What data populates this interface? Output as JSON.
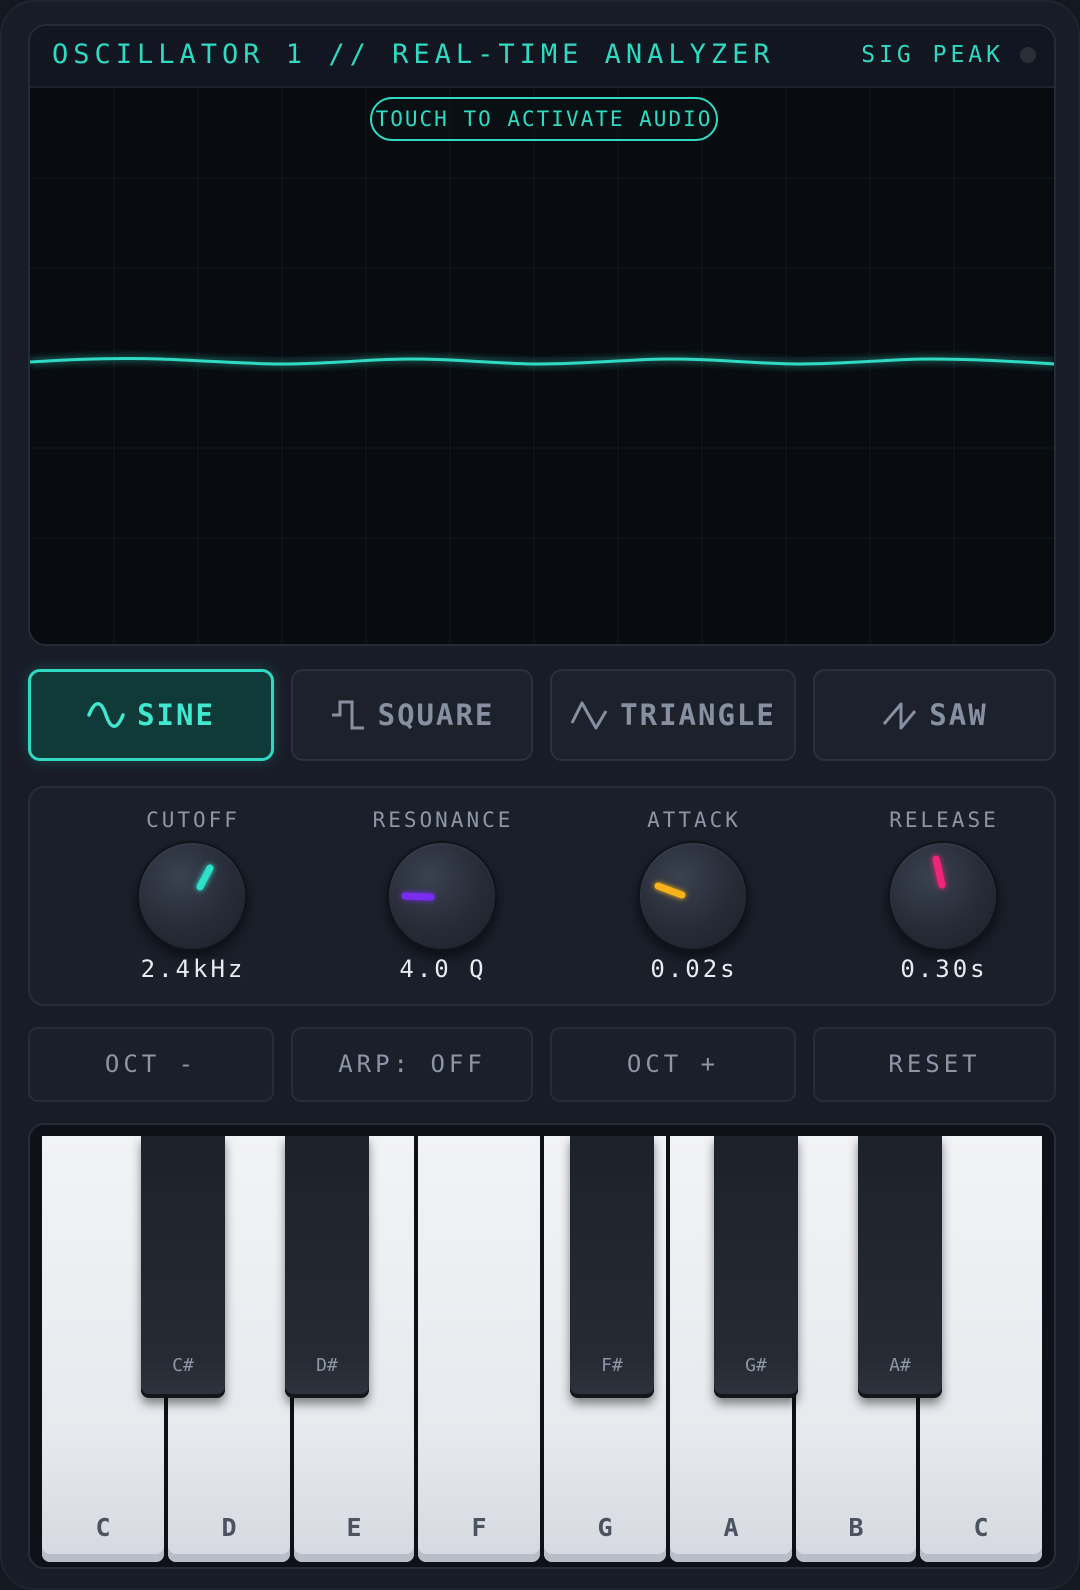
{
  "analyzer": {
    "title": "OSCILLATOR 1 // REAL-TIME ANALYZER",
    "signal_label": "SIG PEAK",
    "activate_label": "TOUCH TO ACTIVATE AUDIO"
  },
  "waveforms": {
    "selected": "SINE",
    "items": [
      {
        "label": "SINE",
        "icon": "sine-wave-icon"
      },
      {
        "label": "SQUARE",
        "icon": "square-wave-icon"
      },
      {
        "label": "TRIANGLE",
        "icon": "triangle-wave-icon"
      },
      {
        "label": "SAW",
        "icon": "saw-wave-icon"
      }
    ]
  },
  "knobs": [
    {
      "label": "CUTOFF",
      "value": "2.4kHz",
      "color": "#2fe0c8"
    },
    {
      "label": "RESONANCE",
      "value": "4.0 Q",
      "color": "#7a2cf0"
    },
    {
      "label": "ATTACK",
      "value": "0.02s",
      "color": "#f7b319"
    },
    {
      "label": "RELEASE",
      "value": "0.30s",
      "color": "#f0247a"
    }
  ],
  "controls": {
    "oct_down": "OCT -",
    "arp": "ARP: OFF",
    "oct_up": "OCT +",
    "reset": "RESET"
  },
  "keyboard": {
    "white_keys": [
      "C",
      "D",
      "E",
      "F",
      "G",
      "A",
      "B",
      "C"
    ],
    "black_keys": [
      "C#",
      "D#",
      "F#",
      "G#",
      "A#"
    ]
  },
  "colors": {
    "accent": "#2fd9c2",
    "background": "#181c26"
  }
}
